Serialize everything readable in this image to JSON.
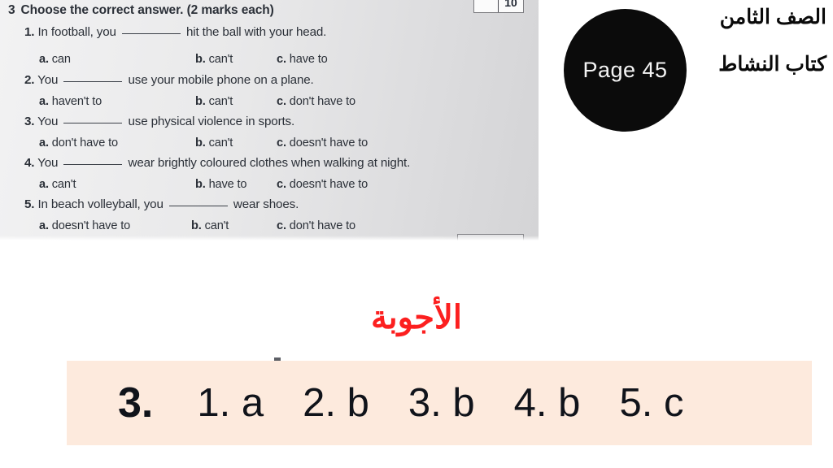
{
  "worksheet": {
    "exercise_number": "3",
    "instruction": "Choose the correct answer. (2 marks each)",
    "score_box": {
      "mark": "",
      "total": "10"
    },
    "questions": [
      {
        "number": "1.",
        "text_before": "In football, you",
        "text_after": "hit the ball with your head.",
        "options": [
          {
            "letter": "a.",
            "text": "can"
          },
          {
            "letter": "b.",
            "text": "can't"
          },
          {
            "letter": "c.",
            "text": "have to"
          }
        ]
      },
      {
        "number": "2.",
        "text_before": "You",
        "text_after": "use your mobile phone on a plane.",
        "options": [
          {
            "letter": "a.",
            "text": "haven't to"
          },
          {
            "letter": "b.",
            "text": "can't"
          },
          {
            "letter": "c.",
            "text": "don't have to"
          }
        ]
      },
      {
        "number": "3.",
        "text_before": "You",
        "text_after": "use physical violence in sports.",
        "options": [
          {
            "letter": "a.",
            "text": "don't have to"
          },
          {
            "letter": "b.",
            "text": "can't"
          },
          {
            "letter": "c.",
            "text": "doesn't have to"
          }
        ]
      },
      {
        "number": "4.",
        "text_before": "You",
        "text_after": "wear brightly coloured clothes when walking at night.",
        "options": [
          {
            "letter": "a.",
            "text": "can't"
          },
          {
            "letter": "b.",
            "text": "have to"
          },
          {
            "letter": "c.",
            "text": "doesn't have to"
          }
        ]
      },
      {
        "number": "5.",
        "text_before": "In beach volleyball, you",
        "text_after": "wear shoes.",
        "options": [
          {
            "letter": "a.",
            "text": "doesn't have to"
          },
          {
            "letter": "b.",
            "text": "can't"
          },
          {
            "letter": "c.",
            "text": "don't have to"
          }
        ]
      }
    ]
  },
  "page_badge": {
    "label": "Page 45"
  },
  "arabic_header": {
    "grade": "الصف الثامن",
    "book": "كتاب النشاط"
  },
  "answers_title": "الأجوبة",
  "answer_strip": {
    "exercise_number": "3.",
    "answers": [
      {
        "number": "1.",
        "choice": "a"
      },
      {
        "number": "2.",
        "choice": "b"
      },
      {
        "number": "3.",
        "choice": "b"
      },
      {
        "number": "4.",
        "choice": "b"
      },
      {
        "number": "5.",
        "choice": "c"
      }
    ]
  },
  "colors": {
    "badge_bg": "#0b0b0b",
    "badge_text": "#f4f4f4",
    "answers_title": "#fc1f1f",
    "strip_bg": "#fdeadd",
    "worksheet_text": "#2b3038"
  }
}
